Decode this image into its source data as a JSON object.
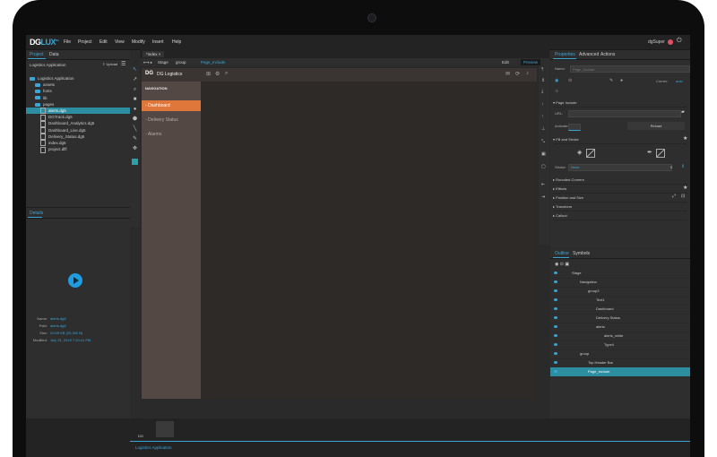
{
  "app": {
    "brand_left": "DG",
    "brand_right": "LUX",
    "brand_sup": "Pro"
  },
  "menu": [
    "File",
    "Project",
    "Edit",
    "View",
    "Modify",
    "Insert",
    "Help"
  ],
  "user": "dgSuper",
  "left_panel": {
    "tabs": [
      "Project",
      "Data"
    ],
    "project_name": "Logistics Application",
    "upload_label": "Upload",
    "tree": [
      {
        "label": "Logistics Application",
        "type": "folder",
        "indent": 0
      },
      {
        "label": "assets",
        "type": "folder",
        "indent": 1
      },
      {
        "label": "fonts",
        "type": "folder",
        "indent": 1
      },
      {
        "label": "lib",
        "type": "folder",
        "indent": 1
      },
      {
        "label": "pages",
        "type": "folder",
        "indent": 1
      },
      {
        "label": "alerts.dg5",
        "type": "file",
        "indent": 2,
        "selected": true
      },
      {
        "label": "DGTrack.dg5",
        "type": "file",
        "indent": 2
      },
      {
        "label": "Dashboard_Analytics.dg5",
        "type": "file",
        "indent": 2
      },
      {
        "label": "Dashboard_Live.dg5",
        "type": "file",
        "indent": 2
      },
      {
        "label": "Delivery_Status.dg5",
        "type": "file",
        "indent": 2
      },
      {
        "label": "index.dg5",
        "type": "file",
        "indent": 2
      },
      {
        "label": "project.dlfl",
        "type": "file",
        "indent": 2
      }
    ],
    "details_title": "Details",
    "details": [
      {
        "k": "Name:",
        "v": "alerts.dg5"
      },
      {
        "k": "Path:",
        "v": "alerts.dg5"
      },
      {
        "k": "Size:",
        "v": "20.69 KB (20,392 B)"
      },
      {
        "k": "Modified:",
        "v": "July 31, 2019 7:33:41 PM"
      }
    ]
  },
  "editor": {
    "tab": "*index",
    "breadcrumb": [
      "Stage",
      "group",
      "Page_Include"
    ],
    "edit_label": "Edit",
    "preview_label": "Preview",
    "doc_title": "DG Logistics",
    "nav_heading": "NAVIGATION",
    "nav_items": [
      {
        "label": "Dashboard",
        "active": true
      },
      {
        "label": "Delivery Status",
        "active": false
      },
      {
        "label": "Alarms",
        "active": false
      }
    ]
  },
  "right_panel": {
    "tabs": [
      "Properties",
      "Advanced",
      "Actions"
    ],
    "name_label": "Name:",
    "name_placeholder": "Page_Include",
    "corner_label": "Corner:",
    "corner_value": "auto",
    "sections": {
      "page_include": "Page Include",
      "url_label": "URL:",
      "activate_label": "Activate:",
      "reload": "Reload",
      "fill_stroke": "Fill and Stroke",
      "stroke_label": "Stroke:",
      "stroke_value": "None",
      "stroke_width": "0",
      "rounded": "Rounded Corners",
      "effects": "Effects",
      "position": "Position and Size",
      "transform": "Transform",
      "callout": "Callout"
    },
    "outline_tabs": [
      "Outline",
      "Symbols"
    ],
    "outline": [
      {
        "label": "Stage",
        "indent": 0,
        "selected": false
      },
      {
        "label": "Navigation",
        "indent": 1,
        "selected": false
      },
      {
        "label": "group3",
        "indent": 2,
        "selected": false
      },
      {
        "label": "Text1",
        "indent": 3,
        "selected": false
      },
      {
        "label": "Dashboard",
        "indent": 3,
        "selected": false
      },
      {
        "label": "Delivery Status",
        "indent": 3,
        "selected": false
      },
      {
        "label": "alerts",
        "indent": 3,
        "selected": false
      },
      {
        "label": "alerts_white",
        "indent": 4,
        "selected": false
      },
      {
        "label": "Type4",
        "indent": 4,
        "selected": false
      },
      {
        "label": "group",
        "indent": 1,
        "selected": false
      },
      {
        "label": "Top Header Bar",
        "indent": 2,
        "selected": false
      },
      {
        "label": "Page_Include",
        "indent": 2,
        "selected": true
      }
    ]
  },
  "bottom": {
    "tab_label": "DG",
    "project_label": "Logistics Application"
  }
}
